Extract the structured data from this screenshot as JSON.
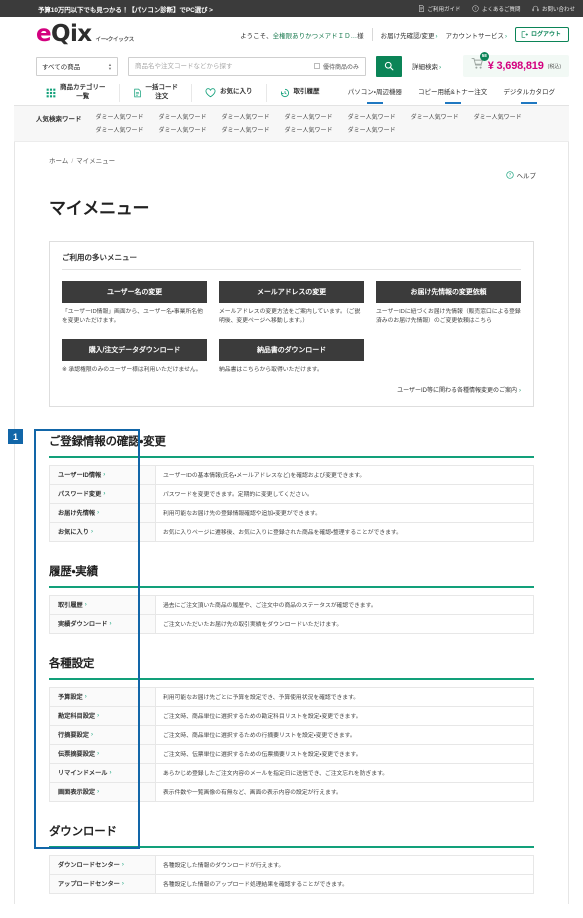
{
  "topbar": {
    "promo": "予算10万円以下でも見つかる！【パソコン診断】でPC選び >",
    "links": [
      {
        "label": "ご利用ガイド",
        "icon": "document-icon"
      },
      {
        "label": "よくあるご質問",
        "icon": "question-circle-icon"
      },
      {
        "label": "お問い合わせ",
        "icon": "headset-icon"
      }
    ]
  },
  "header": {
    "logo_e": "e",
    "logo_rest": "Qix",
    "logo_sub": "イー・クイックス",
    "welcome_prefix": "ようこそ、",
    "welcome_user": "全権限ありかつメアドＩＤ…",
    "welcome_suffix": "様",
    "links": [
      {
        "label": "お届け先確認/変更",
        "chev": "›"
      },
      {
        "label": "アカウントサービス",
        "chev": "›"
      }
    ],
    "logout_label": "ログアウト"
  },
  "search": {
    "category_label": "すべての商品",
    "placeholder": "商品名や注文コードなどから探す",
    "value": "",
    "only_label": "優待商品のみ",
    "only_checked": false,
    "advanced_label": "詳細検索",
    "advanced_chev": "›"
  },
  "cart": {
    "badge_count": "58",
    "amount": "¥ 3,698,819",
    "tax_note": "(税込)"
  },
  "nav": {
    "left_items": [
      {
        "label_line1": "商品カテゴリー",
        "label_line2": "一覧",
        "icon": "grid-icon"
      },
      {
        "label_line1": "一括コード",
        "label_line2": "注文",
        "icon": "document-icon"
      },
      {
        "label_line1": "お気に入り",
        "label_line2": "",
        "icon": "heart-icon"
      },
      {
        "label_line1": "取引履歴",
        "label_line2": "",
        "icon": "history-icon"
      }
    ],
    "right_items": [
      {
        "label": "パソコン・周辺機器"
      },
      {
        "label": "コピー用紙&トナー注文"
      },
      {
        "label": "デジタルカタログ"
      }
    ]
  },
  "keywords": {
    "title": "人気検索ワード",
    "items": [
      "ダミー人気ワード",
      "ダミー人気ワード",
      "ダミー人気ワード",
      "ダミー人気ワード",
      "ダミー人気ワード",
      "ダミー人気ワード",
      "ダミー人気ワード",
      "ダミー人気ワード",
      "ダミー人気ワード",
      "ダミー人気ワード",
      "ダミー人気ワード",
      "ダミー人気ワード"
    ]
  },
  "breadcrumb": {
    "home": "ホーム",
    "separator": "/",
    "current": "マイメニュー"
  },
  "help": {
    "label": "ヘルプ",
    "icon": "question-circle-icon"
  },
  "page_title": "マイメニュー",
  "frequent": {
    "title": "ご利用の多いメニュー",
    "buttons": [
      {
        "label": "ユーザー名の変更",
        "desc": "「ユーザーID情報」画面から、ユーザー名・事業所名他を変更いただけます。"
      },
      {
        "label": "メールアドレスの変更",
        "desc": "メールアドレスの変更方法をご案内しています。（ご説明後、変更ページへ移動します。）"
      },
      {
        "label": "お届け先情報の変更依頼",
        "desc": "ユーザーIDに紐づくお届け先情報（販売窓口による登録済みのお届け先情報）のご変更依頼はこちら"
      }
    ],
    "buttons_row2": [
      {
        "label": "購入/注文データダウンロード",
        "desc": "※ 承認権限のみのユーザー様は利用いただけません。"
      },
      {
        "label": "納品書のダウンロード",
        "desc": "納品書はこちらから取得いただけます。"
      }
    ],
    "after_link": "ユーザーID等に関わる各種情報変更のご案内",
    "after_link_chev": "›"
  },
  "annotation": {
    "number": "1"
  },
  "sections": [
    {
      "title": "ご登録情報の確認・変更",
      "rows": [
        {
          "label": "ユーザーID情報",
          "chev": "›",
          "desc": "ユーザーIDの基本情報(氏名・メールアドレスなど)を確認および変更できます。"
        },
        {
          "label": "パスワード変更",
          "chev": "›",
          "desc": "パスワードを変更できます。定期的に変更してください。"
        },
        {
          "label": "お届け先情報",
          "chev": "›",
          "desc": "利用可能なお届け先の登録情報確認や追加・変更ができます。"
        },
        {
          "label": "お気に入り",
          "chev": "›",
          "desc": "お気に入りページに遷移後、お気に入りに登録された商品を確認・整理することができます。"
        }
      ]
    },
    {
      "title": "履歴・実績",
      "rows": [
        {
          "label": "取引履歴",
          "chev": "›",
          "desc": "過去にご注文頂いた商品の履歴や、ご注文中の商品のステータスが確認できます。"
        },
        {
          "label": "実績ダウンロード",
          "chev": "›",
          "desc": "ご注文いただいたお届け先の取引実績をダウンロードいただけます。"
        }
      ]
    },
    {
      "title": "各種設定",
      "rows": [
        {
          "label": "予算設定",
          "chev": "›",
          "desc": "利用可能なお届け先ごとに予算を設定でき、予算使用状況を確認できます。"
        },
        {
          "label": "勘定科目設定",
          "chev": "›",
          "desc": "ご注文時、商品単位に選択するための勘定科目リストを設定・変更できます。"
        },
        {
          "label": "行摘要設定",
          "chev": "›",
          "desc": "ご注文時、商品単位に選択するための行摘要リストを設定・変更できます。"
        },
        {
          "label": "伝票摘要設定",
          "chev": "›",
          "desc": "ご注文時、伝票単位に選択するための伝票摘要リストを設定・変更できます。"
        },
        {
          "label": "リマインドメール",
          "chev": "›",
          "desc": "あらかじめ登録したご注文内容のメールを指定日に送信でき、ご注文忘れを防ぎます。"
        },
        {
          "label": "画面表示設定",
          "chev": "›",
          "desc": "表示件数や一覧画像の有無など、画面の表示内容の設定が行えます。"
        }
      ]
    },
    {
      "title": "ダウンロード",
      "rows": [
        {
          "label": "ダウンロードセンター",
          "chev": "›",
          "desc": "各種設定した情報のダウンロードが行えます。"
        },
        {
          "label": "アップロードセンター",
          "chev": "›",
          "desc": "各種設定した情報のアップロード処理結果を確認することができます。"
        }
      ]
    }
  ],
  "colors": {
    "brand_magenta": "#d3007f",
    "brand_green": "#0b8457",
    "accent_teal": "#12a07a",
    "nav_underline_blue": "#1f78c1",
    "annotation_blue": "#1266a8",
    "dark_button": "#3b3b3b"
  }
}
